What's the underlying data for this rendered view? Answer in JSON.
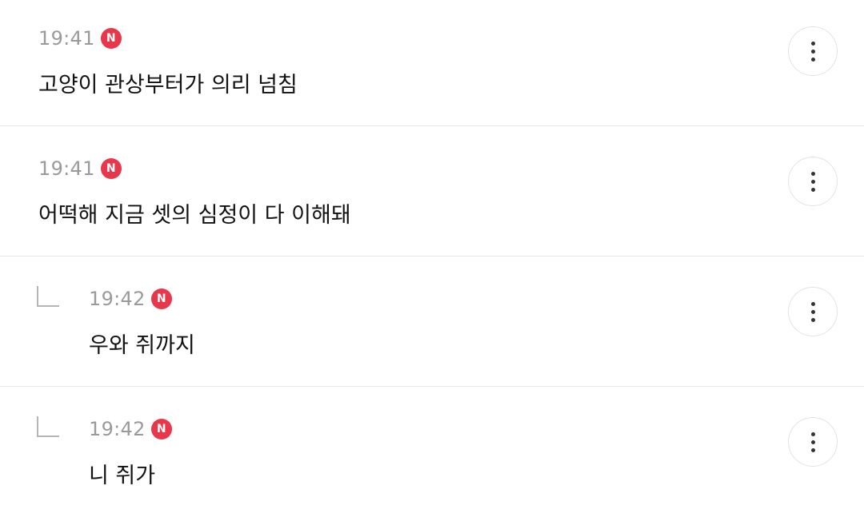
{
  "comments": [
    {
      "time": "19:41",
      "badge": "N",
      "text": "고양이 관상부터가 의리 넘침"
    },
    {
      "time": "19:41",
      "badge": "N",
      "text": "어떡해 지금 셋의 심정이 다 이해돼"
    },
    {
      "time": "19:42",
      "badge": "N",
      "text": "우와 쥐까지"
    },
    {
      "time": "19:42",
      "badge": "N",
      "text": "니 쥐가"
    }
  ],
  "colors": {
    "badge": "#e8374b",
    "time": "#9a9a9a",
    "text": "#111111",
    "divider": "#e6e6e6"
  },
  "icons": {
    "more": "more-vertical-icon",
    "reply": "reply-arrow-icon",
    "new": "new-badge"
  }
}
